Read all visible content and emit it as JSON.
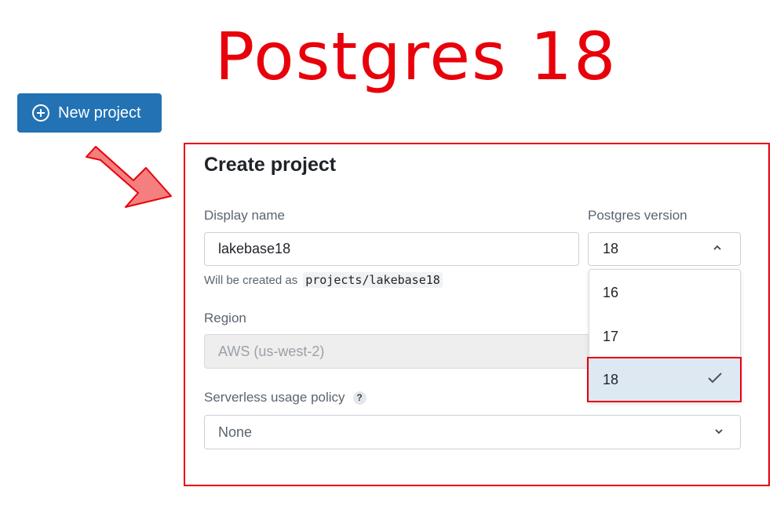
{
  "headline": {
    "text": "Postgres 18",
    "color": "#e8000b"
  },
  "new_project_button": {
    "label": "New project",
    "icon": "plus-circle-icon",
    "background": "#2272b4"
  },
  "dialog": {
    "title": "Create project",
    "display_name": {
      "label": "Display name",
      "value": "lakebase18",
      "hint_prefix": "Will be created as",
      "hint_path": "projects/lakebase18"
    },
    "postgres_version": {
      "label": "Postgres version",
      "selected": "18",
      "icon": "chevron-up-icon",
      "options": [
        {
          "label": "16"
        },
        {
          "label": "17"
        },
        {
          "label": "18",
          "selected": true,
          "icon": "check-icon"
        }
      ]
    },
    "region": {
      "label": "Region",
      "value": "AWS (us-west-2)",
      "disabled": true
    },
    "serverless_usage_policy": {
      "label": "Serverless usage policy",
      "help_icon": "?",
      "value": "None",
      "icon": "chevron-down-icon"
    }
  },
  "annotations": {
    "highlight_color": "#e8000b",
    "arrow_color": "#f47f7f",
    "arrow_icon": "arrow-icon"
  }
}
